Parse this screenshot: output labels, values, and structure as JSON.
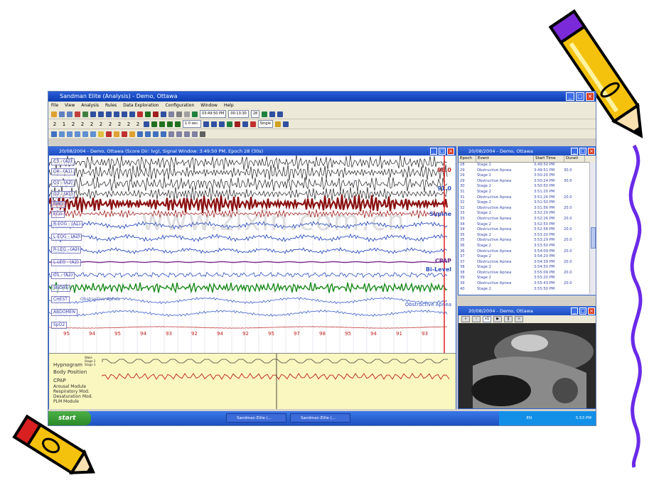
{
  "window": {
    "title": "Sandman Elite (Analysis) - Demo, Ottawa"
  },
  "menu": [
    "File",
    "View",
    "Analysis",
    "Rules",
    "Data Exploration",
    "Configuration",
    "Window",
    "Help"
  ],
  "toolbar": {
    "nums": [
      "2",
      "1",
      "2",
      "2",
      "2",
      "2",
      "2",
      "2",
      "2",
      "2"
    ],
    "time_start": "03:49:50 PM",
    "time_len": "00:13:30",
    "epoch_field": "28",
    "speed": "1.0 sec.",
    "mode": "Single"
  },
  "signal_window": {
    "title": "20/08/2004 - Demo, Ottawa (Score Dir: lvg), Signal Window: 3:49:50 PM, Epoch 28 (30s)",
    "channels": [
      "C3 - (A2)",
      "C4 - (A1)",
      "O1 - (A2)",
      "O2 - (A1)",
      "EMG",
      "ECG",
      "R-EOG - (A1)",
      "L-EOG - (A2)",
      "R-LEG - (A2)",
      "L-LEG - (A2)",
      "O1 - (A2)",
      "SNORE",
      "CHEST",
      "ABDOMEN",
      "SpO2"
    ],
    "right_labels": {
      "a": "98.0",
      "b": "91.0",
      "position": "Supine",
      "cpap": "CPAP",
      "bilevel": "Bi-Level",
      "apnea": "Obstructive Apnea",
      "chest_note": "Obstructive Apnea"
    },
    "spo2": [
      "95",
      "94",
      "95",
      "94",
      "93",
      "92",
      "94",
      "92",
      "95",
      "97",
      "98",
      "95",
      "94",
      "91",
      "93"
    ],
    "hypnogram": {
      "labels": [
        "Hypnogram",
        "Body Position",
        "CPAP",
        "Arousal Module",
        "Respiratory Mod.",
        "Desaturation Mod.",
        "PLM Module"
      ],
      "stages": [
        "Wake",
        "Stage 2",
        "Stage 3"
      ]
    },
    "watermark": "www.zixin.com.cn"
  },
  "event_window": {
    "title": "20/08/2004 - Demo, Ottawa",
    "columns": [
      "Epoch",
      "Event",
      "Start Time",
      "Durati"
    ],
    "rows": [
      [
        "28",
        "Stage 2",
        "3:49:50 PM",
        ""
      ],
      [
        "29",
        "Obstructive Apnea",
        "3:49:51 PM",
        "30.0"
      ],
      [
        "29",
        "Stage 2",
        "3:50:20 PM",
        ""
      ],
      [
        "29",
        "Obstructive Apnea",
        "3:50:24 PM",
        "30.0"
      ],
      [
        "30",
        "Stage 2",
        "3:50:50 PM",
        ""
      ],
      [
        "31",
        "Stage 2",
        "3:51:20 PM",
        ""
      ],
      [
        "31",
        "Obstructive Apnea",
        "3:51:26 PM",
        "20.0"
      ],
      [
        "32",
        "Stage 2",
        "3:51:50 PM",
        ""
      ],
      [
        "32",
        "Obstructive Apnea",
        "3:51:56 PM",
        "20.0"
      ],
      [
        "33",
        "Stage 2",
        "3:52:20 PM",
        ""
      ],
      [
        "33",
        "Obstructive Apnea",
        "3:52:26 PM",
        "20.0"
      ],
      [
        "34",
        "Stage 2",
        "3:52:50 PM",
        ""
      ],
      [
        "34",
        "Obstructive Apnea",
        "3:52:56 PM",
        "20.0"
      ],
      [
        "35",
        "Stage 2",
        "3:53:20 PM",
        ""
      ],
      [
        "35",
        "Obstructive Apnea",
        "3:53:29 PM",
        "20.0"
      ],
      [
        "36",
        "Stage 2",
        "3:53:50 PM",
        ""
      ],
      [
        "36",
        "Obstructive Apnea",
        "3:54:09 PM",
        "20.0"
      ],
      [
        "37",
        "Stage 2",
        "3:54:20 PM",
        ""
      ],
      [
        "37",
        "Obstructive Apnea",
        "3:54:39 PM",
        "20.0"
      ],
      [
        "38",
        "Stage 2",
        "3:54:50 PM",
        ""
      ],
      [
        "38",
        "Obstructive Apnea",
        "3:55:09 PM",
        "20.0"
      ],
      [
        "39",
        "Stage 2",
        "3:55:20 PM",
        ""
      ],
      [
        "39",
        "Obstructive Apnea",
        "3:55:43 PM",
        "20.0"
      ],
      [
        "40",
        "Stage 2",
        "3:55:50 PM",
        ""
      ]
    ]
  },
  "video_window": {
    "title": "20/08/2004 - Demo, Ottawa",
    "speed": "x1"
  },
  "taskbar": {
    "start": "start",
    "tasks": [
      "Sandman Elite (...",
      "Sandman Elite (..."
    ],
    "lang": "EN",
    "clock": "5:53 PM"
  },
  "colors": {
    "title_blue": "#0a3db0",
    "eeg_dark": "#202020",
    "emg_red": "#8a1010",
    "eog_blue": "#3050c0",
    "snore_green": "#1a8a1a",
    "hypno_bg": "#fbf7c0",
    "pencil_yellow": "#f4c20d"
  }
}
